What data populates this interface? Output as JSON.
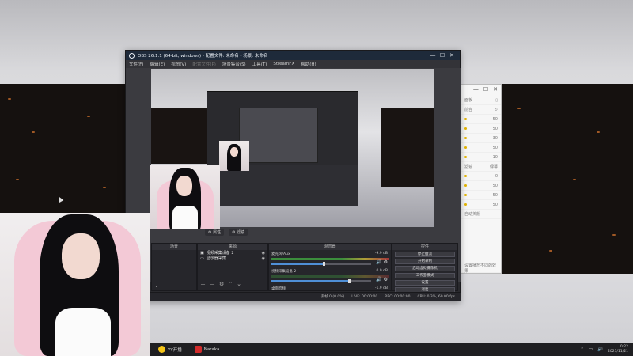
{
  "obs": {
    "title": "OBS 26.1.1 (64-bit, windows) - 配置文件: 未命名 - 场景: 未命名",
    "window_controls": {
      "minimize": "—",
      "maximize": "☐",
      "close": "✕"
    },
    "menu": [
      "文件(F)",
      "编辑(E)",
      "视图(V)",
      "配置文件(P)",
      "场景集合(S)",
      "工具(T)",
      "StreamFX",
      "帮助(H)"
    ],
    "mid_toolbar": [
      "⚙ 属性",
      "⚙ 滤镜"
    ],
    "docks": {
      "scenes": {
        "title": "场景"
      },
      "sources": {
        "title": "来源",
        "items": [
          {
            "name": "视频采集设备 2",
            "icon": "camera-icon"
          },
          {
            "name": "显示器采集",
            "icon": "monitor-icon"
          }
        ]
      },
      "mixer": {
        "title": "混音器",
        "channels": [
          {
            "name": "麦克风/Aux",
            "db": "-9.9 dB",
            "level": 0.52
          },
          {
            "name": "视频采集设备 2",
            "db": "0.0 dB",
            "level": 0.78
          },
          {
            "name": "桌面音频",
            "db": "-1.9 dB",
            "level": 0.3
          }
        ]
      },
      "controls": {
        "title": "控件",
        "buttons": [
          "停止推流",
          "开始录制",
          "启动虚拟摄像机",
          "工作室模式",
          "设置",
          "退出"
        ]
      }
    },
    "statusbar": [
      "丢帧 0 (0.0%)",
      "LIVE: 00:00:00",
      "REC: 00:00:00",
      "CPU: 0.3%, 60.00 fps"
    ]
  },
  "side_app": {
    "title_buttons": [
      "—",
      "☐",
      "✕"
    ],
    "labels": [
      "面板",
      "前台",
      "滤镜",
      "绿幕",
      "自动美颜"
    ],
    "values": [
      "50",
      "50",
      "30",
      "50",
      "10",
      "0",
      "50",
      "50",
      "50"
    ],
    "footer": "设置播放不同的效果"
  },
  "taskbar": {
    "items": [
      {
        "label": "YY开播",
        "icon": "yy-icon",
        "color": "#f5c518"
      },
      {
        "label": "Naraka",
        "icon": "naraka-icon",
        "color": "#d22b2b"
      }
    ],
    "tray_icons": [
      "⌃",
      "▭",
      "🔊"
    ],
    "time": "0:22",
    "date": "2021/11/21"
  }
}
